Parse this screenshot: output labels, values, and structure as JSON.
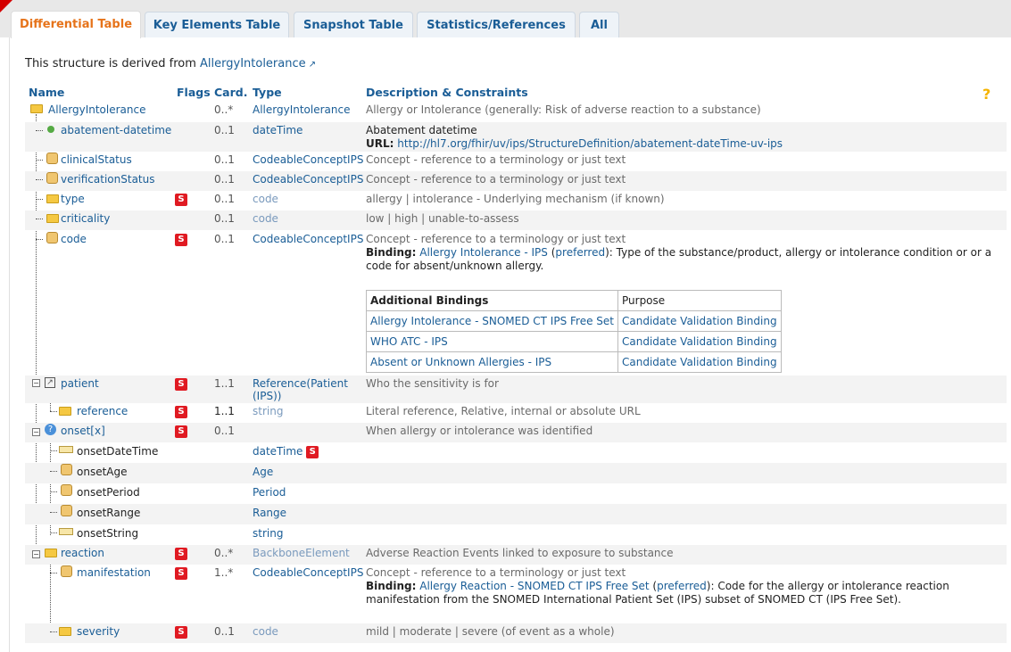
{
  "tabs": [
    {
      "label": "Differential Table",
      "active": true
    },
    {
      "label": "Key Elements Table",
      "active": false
    },
    {
      "label": "Snapshot Table",
      "active": false
    },
    {
      "label": "Statistics/References",
      "active": false
    },
    {
      "label": "All",
      "active": false
    }
  ],
  "derived": {
    "prefix": "This structure is derived from ",
    "link": "AllergyIntolerance"
  },
  "headers": {
    "name": "Name",
    "flags": "Flags",
    "card": "Card.",
    "type": "Type",
    "desc": "Description & Constraints"
  },
  "rows": {
    "root": {
      "name": "AllergyIntolerance",
      "card": "0..*",
      "type": "AllergyIntolerance",
      "desc": "Allergy or Intolerance (generally: Risk of adverse reaction to a substance)"
    },
    "abatement": {
      "name": "abatement-datetime",
      "card": "0..1",
      "type": "dateTime",
      "desc": "Abatement datetime",
      "url_label": "URL:",
      "url": "http://hl7.org/fhir/uv/ips/StructureDefinition/abatement-dateTime-uv-ips"
    },
    "clinicalStatus": {
      "name": "clinicalStatus",
      "card": "0..1",
      "type": "CodeableConceptIPS",
      "desc": "Concept - reference to a terminology or just text"
    },
    "verificationStatus": {
      "name": "verificationStatus",
      "card": "0..1",
      "type": "CodeableConceptIPS",
      "desc": "Concept - reference to a terminology or just text"
    },
    "type": {
      "name": "type",
      "flag": "S",
      "card": "0..1",
      "type": "code",
      "desc": "allergy | intolerance - Underlying mechanism (if known)"
    },
    "criticality": {
      "name": "criticality",
      "card": "0..1",
      "type": "code",
      "desc": "low | high | unable-to-assess"
    },
    "code": {
      "name": "code",
      "flag": "S",
      "card": "0..1",
      "type": "CodeableConceptIPS",
      "desc": "Concept - reference to a terminology or just text",
      "binding_label": "Binding:",
      "binding_link": "Allergy Intolerance - IPS",
      "binding_strength": "preferred",
      "binding_text": ": Type of the substance/product, allergy or intolerance condition or or a code for absent/unknown allergy."
    },
    "patient": {
      "name": "patient",
      "flag": "S",
      "card": "1..1",
      "type_pre": "Reference(",
      "type_link": "Patient (IPS)",
      "type_post": ")",
      "desc": "Who the sensitivity is for"
    },
    "reference": {
      "name": "reference",
      "flag": "S",
      "card": "1..1",
      "type": "string",
      "desc": "Literal reference, Relative, internal or absolute URL"
    },
    "onset": {
      "name": "onset[x]",
      "flag": "S",
      "card": "0..1",
      "desc": "When allergy or intolerance was identified"
    },
    "onsetDateTime": {
      "name": "onsetDateTime",
      "type": "dateTime",
      "flag": "S"
    },
    "onsetAge": {
      "name": "onsetAge",
      "type": "Age"
    },
    "onsetPeriod": {
      "name": "onsetPeriod",
      "type": "Period"
    },
    "onsetRange": {
      "name": "onsetRange",
      "type": "Range"
    },
    "onsetString": {
      "name": "onsetString",
      "type": "string"
    },
    "reaction": {
      "name": "reaction",
      "flag": "S",
      "card": "0..*",
      "type": "BackboneElement",
      "desc": "Adverse Reaction Events linked to exposure to substance"
    },
    "manifestation": {
      "name": "manifestation",
      "flag": "S",
      "card": "1..*",
      "type": "CodeableConceptIPS",
      "desc": "Concept - reference to a terminology or just text",
      "binding_label": "Binding:",
      "binding_link": "Allergy Reaction - SNOMED CT IPS Free Set",
      "binding_strength": "preferred",
      "binding_text": ": Code for the allergy or intolerance reaction manifestation from the SNOMED International Patient Set (IPS) subset of SNOMED CT (IPS Free Set)."
    },
    "severity": {
      "name": "severity",
      "flag": "S",
      "card": "0..1",
      "type": "code",
      "desc": "mild | moderate | severe (of event as a whole)"
    }
  },
  "bindings": {
    "header": {
      "col1": "Additional Bindings",
      "col2": "Purpose"
    },
    "rows": [
      {
        "name": "Allergy Intolerance - SNOMED CT IPS Free Set",
        "purpose": "Candidate Validation Binding"
      },
      {
        "name": "WHO ATC - IPS",
        "purpose": "Candidate Validation Binding"
      },
      {
        "name": "Absent or Unknown Allergies - IPS",
        "purpose": "Candidate Validation Binding"
      }
    ]
  },
  "colors": {
    "tab_active": "#e6731a",
    "link": "#1a5d96",
    "flag_badge": "#e01a22"
  }
}
